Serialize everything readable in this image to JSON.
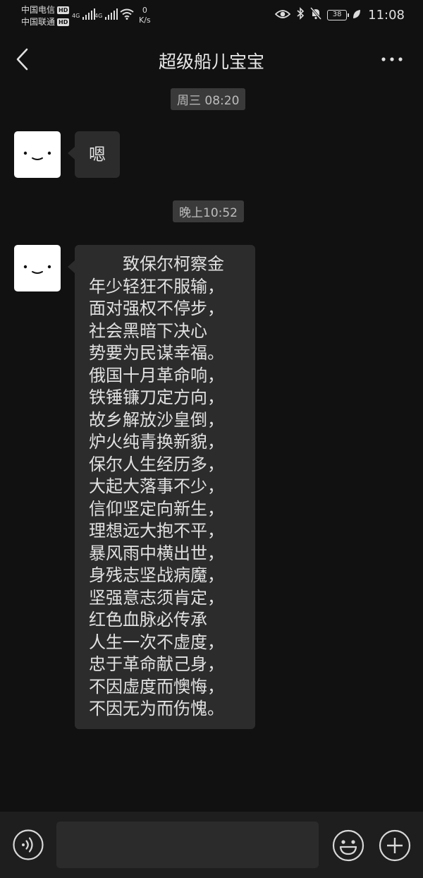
{
  "status_bar": {
    "carrier_1": "中国电信",
    "carrier_2": "中国联通",
    "hd_badge": "HD",
    "network_type": "4G",
    "net_speed_value": "0",
    "net_speed_unit": "K/s",
    "battery_level": "38",
    "time": "11:08"
  },
  "header": {
    "title": "超级船儿宝宝",
    "back_icon": "chevron-left-icon",
    "more_icon": "more-dots-icon"
  },
  "messages": [
    {
      "type": "timestamp",
      "text": "周三 08:20"
    },
    {
      "type": "incoming",
      "text": "嗯"
    },
    {
      "type": "timestamp",
      "text": "晚上10:52"
    },
    {
      "type": "incoming",
      "lines": [
        "致保尔柯察金",
        "年少轻狂不服输，",
        "面对强权不停步，",
        "社会黑暗下决心",
        "势要为民谋幸福。",
        "俄国十月革命响，",
        "铁锤镰刀定方向，",
        "故乡解放沙皇倒，",
        "炉火纯青换新貌，",
        "保尔人生经历多，",
        "大起大落事不少，",
        "信仰坚定向新生，",
        "理想远大抱不平，",
        "暴风雨中横出世，",
        "身残志坚战病魔，",
        "坚强意志须肯定，",
        "红色血脉必传承",
        "人生一次不虚度，",
        "忠于革命献己身，",
        "不因虚度而懊悔，",
        "不因无为而伤愧。"
      ]
    }
  ],
  "input_bar": {
    "voice_icon": "voice-icon",
    "input_value": "",
    "emoji_icon": "emoji-icon",
    "plus_icon": "plus-icon"
  },
  "colors": {
    "background": "#111111",
    "bubble": "#2c2c2c",
    "timestamp_pill": "#3a3a3a",
    "input_bar": "#1e1e1e"
  }
}
